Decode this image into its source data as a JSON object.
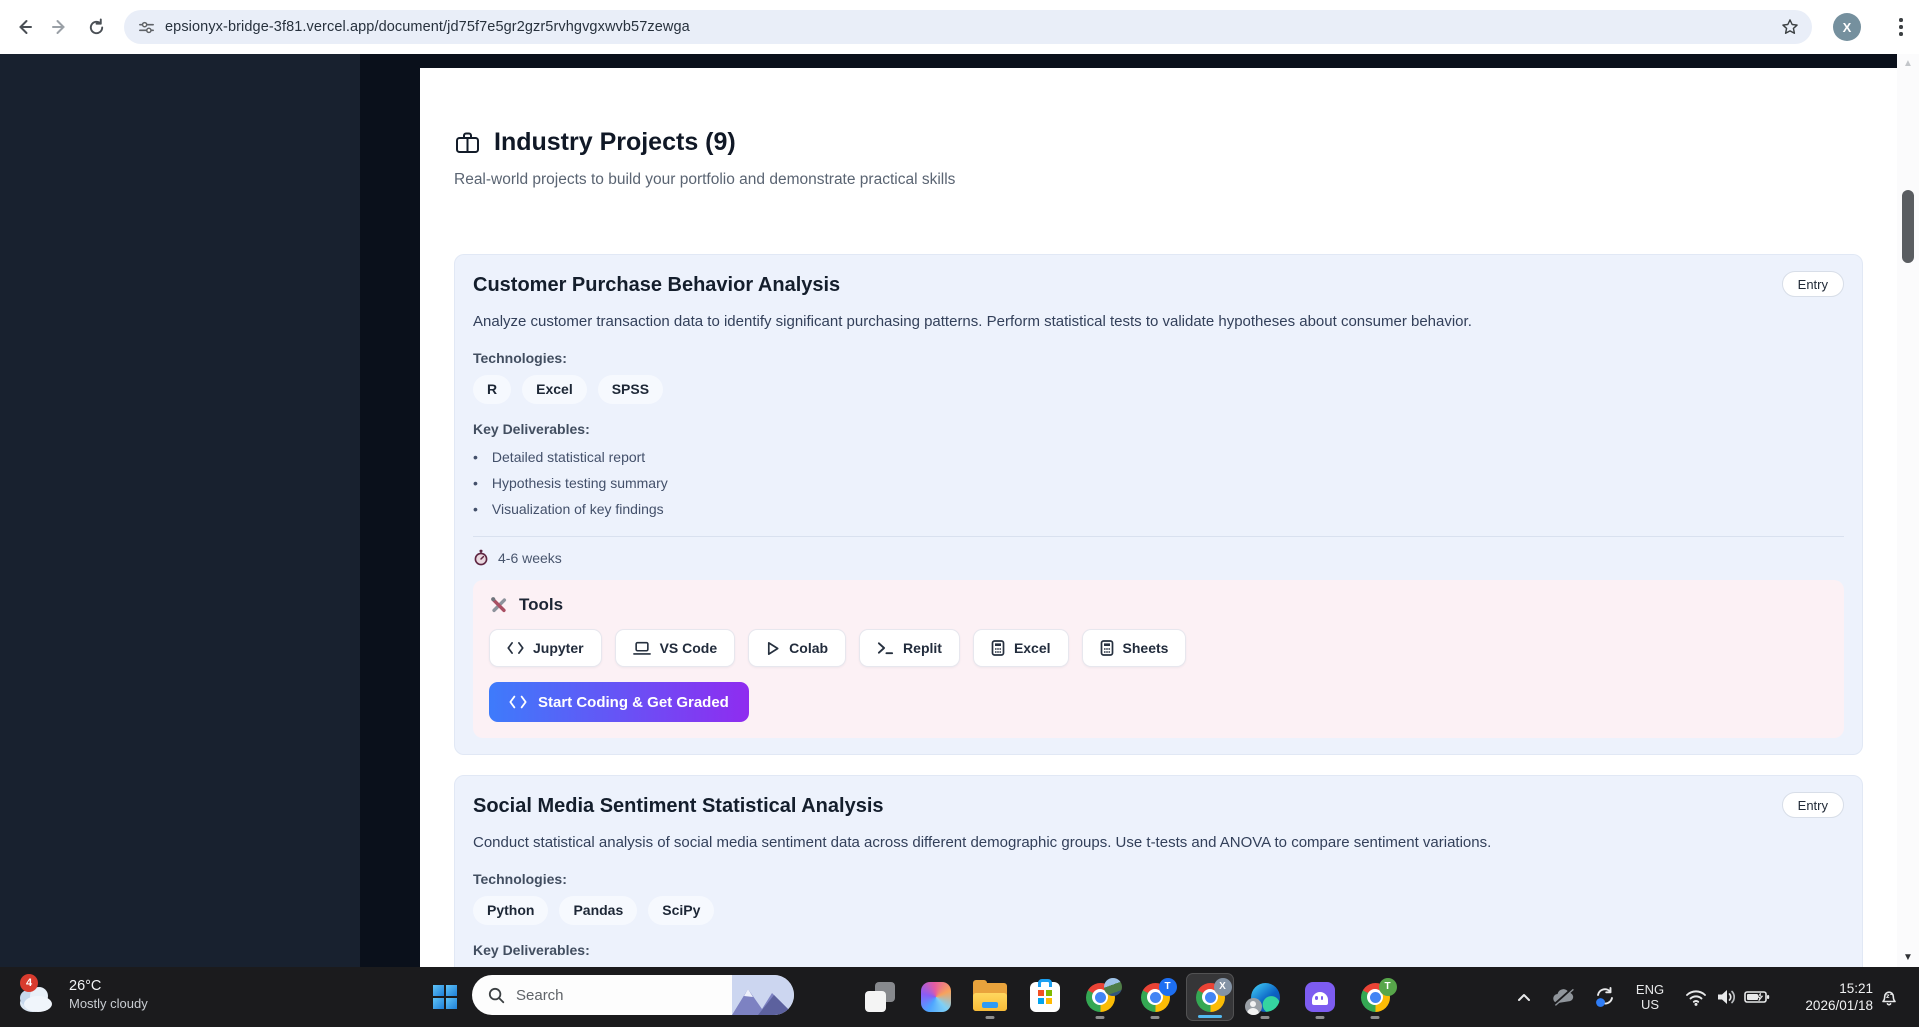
{
  "browser": {
    "url": "epsionyx-bridge-3f81.vercel.app/document/jd75f7e5gr2gzr5rvhgvgxwvb57zewga",
    "avatar_label": "X"
  },
  "page": {
    "title": "Industry Projects (9)",
    "subtitle": "Real-world projects to build your portfolio and demonstrate practical skills",
    "cards": [
      {
        "title": "Customer Purchase Behavior Analysis",
        "level": "Entry",
        "description": "Analyze customer transaction data to identify significant purchasing patterns. Perform statistical tests to validate hypotheses about consumer behavior.",
        "tech_label": "Technologies:",
        "technologies": [
          "R",
          "Excel",
          "SPSS"
        ],
        "deliverables_label": "Key Deliverables:",
        "deliverables": [
          "Detailed statistical report",
          "Hypothesis testing summary",
          "Visualization of key findings"
        ],
        "duration": "4-6 weeks",
        "tools": {
          "label": "Tools",
          "buttons": [
            "Jupyter",
            "VS Code",
            "Colab",
            "Replit",
            "Excel",
            "Sheets"
          ],
          "cta": "Start Coding & Get Graded"
        }
      },
      {
        "title": "Social Media Sentiment Statistical Analysis",
        "level": "Entry",
        "description": "Conduct statistical analysis of social media sentiment data across different demographic groups. Use t-tests and ANOVA to compare sentiment variations.",
        "tech_label": "Technologies:",
        "technologies": [
          "Python",
          "Pandas",
          "SciPy"
        ],
        "deliverables_label": "Key Deliverables:"
      }
    ]
  },
  "taskbar": {
    "weather": {
      "badge": "4",
      "temp": "26°C",
      "condition": "Mostly cloudy"
    },
    "search_placeholder": "Search",
    "chrome_badge_profile2": "T",
    "chrome_badge_profile3": "X",
    "chrome_badge_profile4": "T",
    "tray": {
      "lang_line1": "ENG",
      "lang_line2": "US",
      "time": "15:21",
      "date": "2026/01/18"
    }
  },
  "colors": {
    "cta_gradient_start": "#3e7bfb",
    "cta_gradient_end": "#8f2cf0",
    "card_bg": "#edf2fc",
    "tools_bg": "#fcf1f5",
    "sidebar_bg": "#18212f",
    "taskbar_bg": "#1b1b1d",
    "active_indicator": "#53b9f0"
  }
}
